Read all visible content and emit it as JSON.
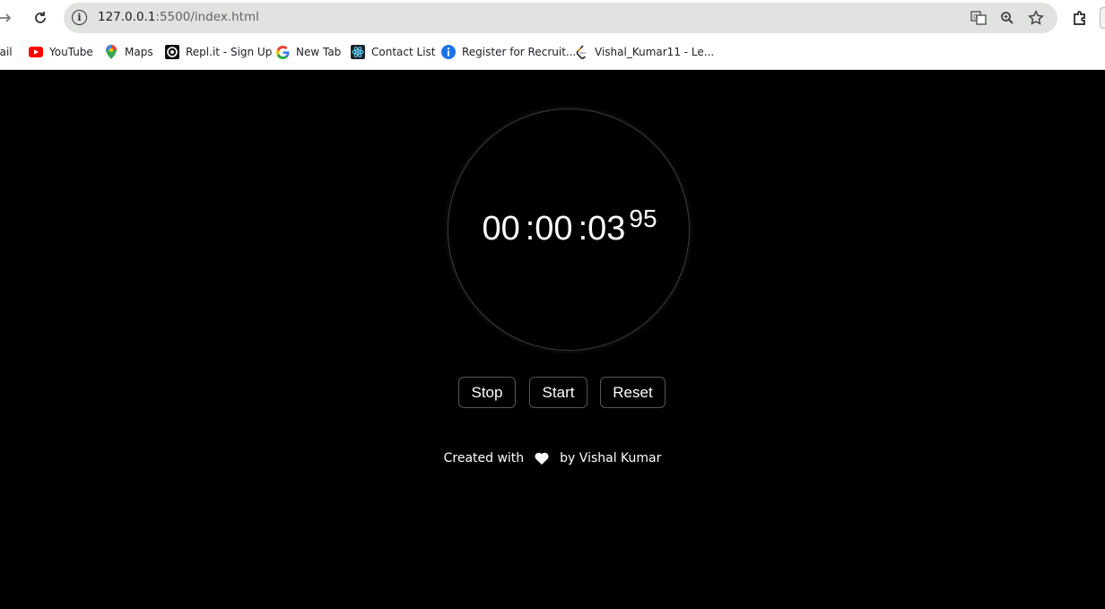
{
  "browser": {
    "url_host": "127.0.0.1",
    "url_rest": ":5500/index.html",
    "bookmarks": [
      {
        "label": "nail",
        "icon": "gmail-icon"
      },
      {
        "label": "YouTube",
        "icon": "youtube-icon"
      },
      {
        "label": "Maps",
        "icon": "maps-icon"
      },
      {
        "label": "Repl.it - Sign Up",
        "icon": "replit-icon"
      },
      {
        "label": "New Tab",
        "icon": "google-icon"
      },
      {
        "label": "Contact List",
        "icon": "react-icon"
      },
      {
        "label": "Register for Recruit...",
        "icon": "info-icon"
      },
      {
        "label": "Vishal_Kumar11 - Le...",
        "icon": "leetcode-icon"
      }
    ]
  },
  "stopwatch": {
    "hours": "00",
    "sep1": ":",
    "minutes": "00",
    "sep2": ":",
    "seconds": "03",
    "milliseconds": "95"
  },
  "controls": {
    "stop_label": "Stop",
    "start_label": "Start",
    "reset_label": "Reset"
  },
  "footer": {
    "prefix": "Created with",
    "suffix": "by Vishal Kumar",
    "icon": "heart-icon"
  },
  "colors": {
    "background": "#000000",
    "text": "#ffffff",
    "button_border": "#555555"
  }
}
